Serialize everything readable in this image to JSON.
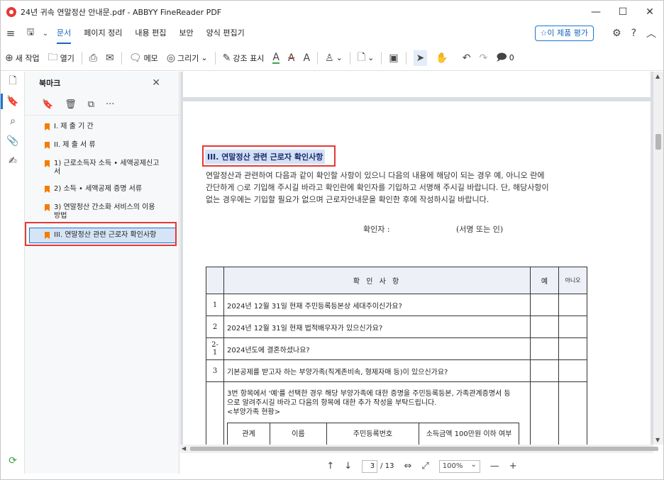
{
  "window": {
    "title": "24년 귀속 연말정산 안내문.pdf - ABBYY FineReader PDF",
    "min": "—",
    "max": "☐",
    "close": "✕"
  },
  "menu": {
    "items": [
      "문서",
      "페이지 정리",
      "내용 편집",
      "보안",
      "양식 편집기"
    ],
    "rate_button": "이 제품 평가"
  },
  "toolbar": {
    "new_task": "새 작업",
    "open": "열기",
    "memo": "메모",
    "draw": "그리기",
    "highlight": "강조 표시",
    "text_a": "A",
    "comments_count": "0"
  },
  "bookmarks": {
    "title": "북마크",
    "items": [
      {
        "label": "I. 제 출 기 간"
      },
      {
        "label": "II. 제 출 서 류"
      },
      {
        "label": "1) 근로소득자 소득 • 세액공제신고서"
      },
      {
        "label": "2) 소득 • 세액공제 증명 서류"
      },
      {
        "label": "3) 연말정산 간소화 서비스의 이용방법"
      },
      {
        "label": "III. 연말정산 관련 근로자 확인사항"
      }
    ]
  },
  "document": {
    "section_title": "III. 연말정산 관련 근로자 확인사항",
    "paragraph": [
      "연말정산과 관련하여 다음과 같이 확인할 사항이 있으니 다음의 내용에 해당이 되는 경우 예, 아니오 란에",
      "간단하게 ○로 기입해 주시길 바라고 확인란에 확인자를 기입하고 서명해 주시길 바랍니다. 단, 해당사항이",
      "없는 경우에는 기입할 필요가 없으며 근로자안내문을 확인한 후에 작성하시길 바랍니다."
    ],
    "confirmer_label": "확인자 :",
    "signature_label": "(서명 또는 인)",
    "table": {
      "header": "확 인 사 항",
      "yes": "예",
      "no": "아니오",
      "rows": [
        {
          "num": "1",
          "text": "2024년 12월 31일 현재 주민등록등본상 세대주이신가요?"
        },
        {
          "num": "2",
          "text": "2024년 12월 31일 현재 법적배우자가 있으신가요?"
        },
        {
          "num": "2-1",
          "text": "2024년도에 결혼하셨나요?"
        },
        {
          "num": "3",
          "text": "기본공제를 받고자 하는 부양가족(직계존비속, 형제자매 등)이 있으신가요?"
        }
      ],
      "row3_detail": [
        "3번 항목에서 '예'를 선택한 경우 해당 부양가족에 대한 증명을 주민등록등본, 가족관계증명서 등",
        "으로 알려주시길 바라고 다음의 항목에 대한 추가 작성을 부탁드립니다.",
        "<부양가족 현황>"
      ],
      "sub_headers": [
        "관계",
        "이름",
        "주민등록번호",
        "소득금액 100만원 이하 여부"
      ]
    }
  },
  "status": {
    "current_page": "3",
    "total_pages": "/ 13",
    "zoom": "100%"
  }
}
